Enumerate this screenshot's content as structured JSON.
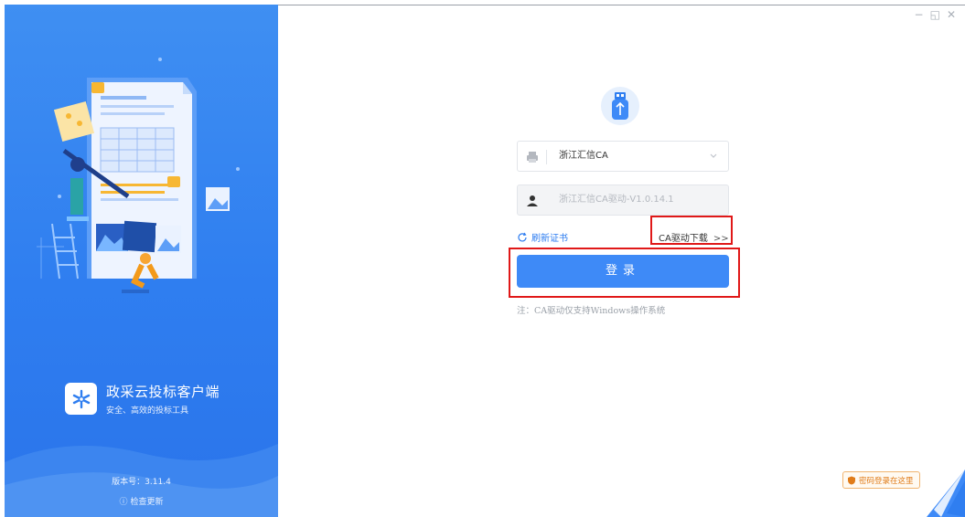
{
  "window_controls": {
    "minimize": "−",
    "restore": "◱",
    "close": "✕"
  },
  "brand": {
    "title": "政采云投标客户端",
    "subtitle": "安全、高效的投标工具"
  },
  "footer": {
    "version": "版本号：3.11.4",
    "check_update": "检查更新"
  },
  "form": {
    "ca_select": {
      "value": "浙江汇信CA",
      "icon": "printer-icon"
    },
    "cert_input": {
      "placeholder": "浙江汇信CA驱动-V1.0.14.1",
      "icon": "user-icon"
    },
    "refresh_label": "刷新证书",
    "ca_download_label": "CA驱动下载",
    "ca_download_arrow": ">>",
    "login_label": "登录",
    "note": "注：CA驱动仅支持Windows操作系统"
  },
  "password_login": {
    "label": "密码登录在这里",
    "icon": "shield-icon"
  },
  "colors": {
    "primary": "#3e8af7",
    "panel": "#2f7ef0",
    "highlight": "#e01818",
    "warn": "#e07c1a"
  }
}
